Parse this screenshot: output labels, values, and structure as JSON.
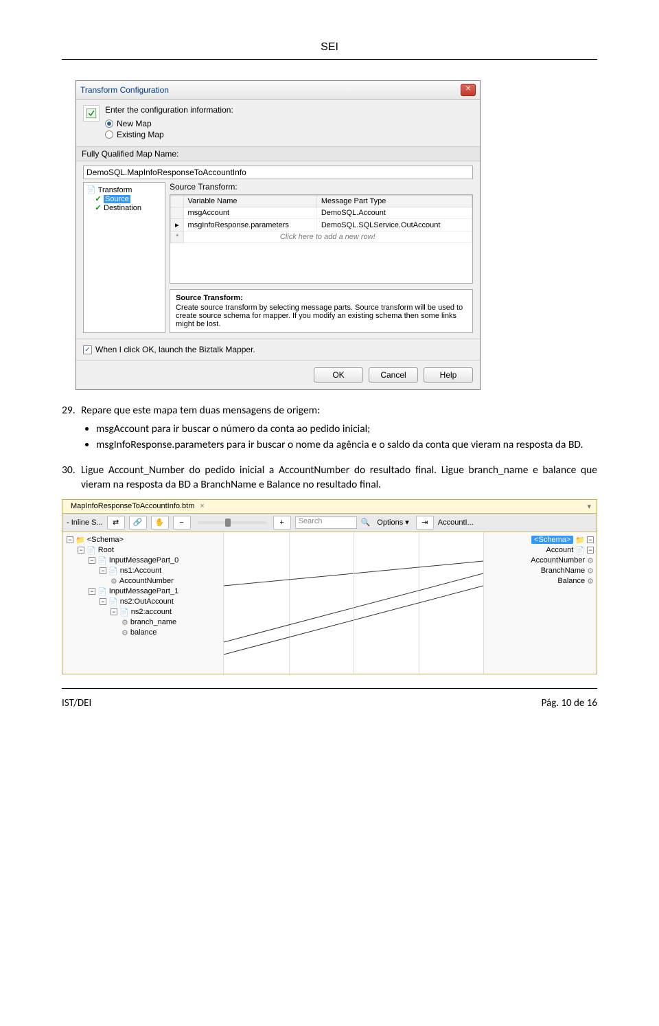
{
  "header": {
    "title": "SEI"
  },
  "dialog": {
    "title": "Transform Configuration",
    "instruction": "Enter the configuration information:",
    "options": {
      "newMap": "New Map",
      "existingMap": "Existing Map"
    },
    "mapNameLabel": "Fully Qualified Map Name:",
    "mapNameValue": "DemoSQL.MapInfoResponseToAccountInfo",
    "tree": {
      "root": "Transform",
      "source": "Source",
      "dest": "Destination"
    },
    "sourceLabel": "Source Transform:",
    "gridHeaders": {
      "var": "Variable Name",
      "type": "Message Part Type"
    },
    "gridRows": [
      {
        "var": "msgAccount",
        "type": "DemoSQL.Account"
      },
      {
        "var": "msgInfoResponse.parameters",
        "type": "DemoSQL.SQLService.OutAccount"
      }
    ],
    "newRowHint": "Click here to add a new row!",
    "descTitle": "Source Transform:",
    "descText": "Create source transform by selecting message parts. Source transform will be used to create source schema for mapper. If you modify an existing schema then some links might be lost.",
    "launchCheck": "When I click OK, launch the Biztalk Mapper.",
    "buttons": {
      "ok": "OK",
      "cancel": "Cancel",
      "help": "Help"
    }
  },
  "body": {
    "item29num": "29.",
    "item29text": "Repare que este mapa tem duas mensagens de origem:",
    "bullet1": "msgAccount para ir buscar o número da conta ao pedido inicial;",
    "bullet2": "msgInfoResponse.parameters para ir buscar o nome da agência e o saldo da conta que vieram na resposta da BD.",
    "item30num": "30.",
    "item30text": "Ligue Account_Number do pedido inicial a AccountNumber do resultado final. Ligue branch_name e balance que vieram na resposta da BD a BranchName e Balance no resultado final."
  },
  "mapper": {
    "tabName": "MapInfoResponseToAccountInfo.btm",
    "inlineLabel": "- Inline S...",
    "searchPlaceholder": "Search",
    "optionsLabel": "Options",
    "rightCrumb": "AccountI...",
    "left": {
      "schema": "<Schema>",
      "root": "Root",
      "imp0": "InputMessagePart_0",
      "ns1acc": "ns1:Account",
      "accnum": "AccountNumber",
      "imp1": "InputMessagePart_1",
      "ns2out": "ns2:OutAccount",
      "ns2acc": "ns2:account",
      "branch": "branch_name",
      "balance": "balance"
    },
    "right": {
      "schema": "<Schema>",
      "account": "Account",
      "accnum": "AccountNumber",
      "branch": "BranchName",
      "balance": "Balance"
    }
  },
  "footer": {
    "left": "IST/DEI",
    "right": "Pág. 10 de 16"
  }
}
